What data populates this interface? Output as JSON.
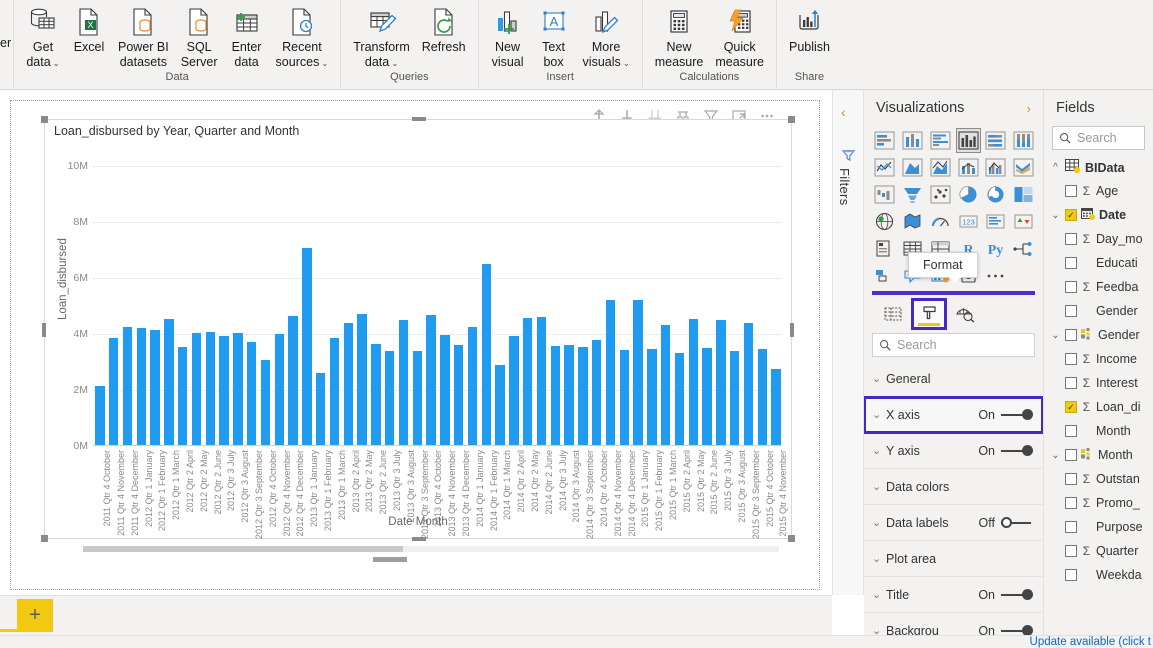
{
  "ribbon": {
    "cut_label": "er",
    "groups": [
      {
        "label": "Data",
        "buttons": [
          {
            "name": "get-data",
            "icon": "database-icon",
            "line1": "Get",
            "line2": "data",
            "caret": true
          },
          {
            "name": "excel",
            "icon": "excel-icon",
            "line1": "Excel",
            "line2": "",
            "caret": false
          },
          {
            "name": "power-bi-datasets",
            "icon": "powerbi-dataset-icon",
            "line1": "Power BI",
            "line2": "datasets",
            "caret": false
          },
          {
            "name": "sql-server",
            "icon": "sql-server-icon",
            "line1": "SQL",
            "line2": "Server",
            "caret": false
          },
          {
            "name": "enter-data",
            "icon": "grid-plus-icon",
            "line1": "Enter",
            "line2": "data",
            "caret": false
          },
          {
            "name": "recent-sources",
            "icon": "clock-page-icon",
            "line1": "Recent",
            "line2": "sources",
            "caret": true
          }
        ]
      },
      {
        "label": "Queries",
        "buttons": [
          {
            "name": "transform-data",
            "icon": "transform-pencil-icon",
            "line1": "Transform",
            "line2": "data",
            "caret": true
          },
          {
            "name": "refresh",
            "icon": "refresh-icon",
            "line1": "Refresh",
            "line2": "",
            "caret": false
          }
        ]
      },
      {
        "label": "Insert",
        "buttons": [
          {
            "name": "new-visual",
            "icon": "new-visual-icon",
            "line1": "New",
            "line2": "visual",
            "caret": false
          },
          {
            "name": "text-box",
            "icon": "text-box-icon",
            "line1": "Text",
            "line2": "box",
            "caret": false
          },
          {
            "name": "more-visuals",
            "icon": "more-visuals-icon",
            "line1": "More",
            "line2": "visuals",
            "caret": true
          }
        ]
      },
      {
        "label": "Calculations",
        "buttons": [
          {
            "name": "new-measure",
            "icon": "calculator-icon",
            "line1": "New",
            "line2": "measure",
            "caret": false
          },
          {
            "name": "quick-measure",
            "icon": "quick-measure-icon",
            "line1": "Quick",
            "line2": "measure",
            "caret": false
          }
        ]
      },
      {
        "label": "Share",
        "buttons": [
          {
            "name": "publish",
            "icon": "publish-icon",
            "line1": "Publish",
            "line2": "",
            "caret": false
          }
        ]
      }
    ]
  },
  "visual_header": {
    "icons": [
      {
        "name": "drill-up-icon",
        "title": "Drill up"
      },
      {
        "name": "drill-down-icon",
        "title": "Drill down"
      },
      {
        "name": "expand-all-icon",
        "title": "Expand all down one level"
      },
      {
        "name": "drill-mode-icon",
        "title": "Go to the next level"
      },
      {
        "name": "filter-icon",
        "title": "Filters"
      },
      {
        "name": "focus-mode-icon",
        "title": "Focus mode"
      },
      {
        "name": "more-options-icon",
        "title": "More options"
      }
    ]
  },
  "chart_data": {
    "type": "bar",
    "title": "Loan_disbursed by Year, Quarter and Month",
    "xlabel": "Date Month",
    "ylabel": "Loan_disbursed",
    "ylim": [
      0,
      10000000
    ],
    "ytick_labels": [
      "0M",
      "2M",
      "4M",
      "6M",
      "8M",
      "10M"
    ],
    "ytick_values": [
      0,
      2000000,
      4000000,
      6000000,
      8000000,
      10000000
    ],
    "grid": true,
    "legend": "none",
    "bar_color": "#1f9cf0",
    "categories": [
      "2011 Qtr 4 October",
      "2011 Qtr 4 November",
      "2011 Qtr 4 December",
      "2012 Qtr 1 January",
      "2012 Qtr 1 February",
      "2012 Qtr 1 March",
      "2012 Qtr 2 April",
      "2012 Qtr 2 May",
      "2012 Qtr 2 June",
      "2012 Qtr 3 July",
      "2012 Qtr 3 August",
      "2012 Qtr 3 September",
      "2012 Qtr 4 October",
      "2012 Qtr 4 November",
      "2012 Qtr 4 December",
      "2013 Qtr 1 January",
      "2013 Qtr 1 February",
      "2013 Qtr 1 March",
      "2013 Qtr 2 April",
      "2013 Qtr 2 May",
      "2013 Qtr 2 June",
      "2013 Qtr 3 July",
      "2013 Qtr 3 August",
      "2013 Qtr 3 September",
      "2013 Qtr 4 October",
      "2013 Qtr 4 November",
      "2013 Qtr 4 December",
      "2014 Qtr 1 January",
      "2014 Qtr 1 February",
      "2014 Qtr 1 March",
      "2014 Qtr 2 April",
      "2014 Qtr 2 May",
      "2014 Qtr 2 June",
      "2014 Qtr 3 July",
      "2014 Qtr 3 August",
      "2014 Qtr 3 September",
      "2014 Qtr 4 October",
      "2014 Qtr 4 November",
      "2014 Qtr 4 December",
      "2015 Qtr 1 January",
      "2015 Qtr 1 February",
      "2015 Qtr 1 March",
      "2015 Qtr 2 April",
      "2015 Qtr 2 May",
      "2015 Qtr 2 June",
      "2015 Qtr 3 July",
      "2015 Qtr 3 August",
      "2015 Qtr 3 September",
      "2015 Qtr 4 October",
      "2015 Qtr 4 November"
    ],
    "values": [
      2150000,
      3840000,
      4240000,
      4230000,
      4150000,
      4520000,
      3540000,
      4050000,
      4060000,
      3930000,
      4020000,
      3720000,
      3060000,
      4000000,
      4630000,
      7060000,
      2620000,
      3840000,
      4380000,
      4730000,
      3660000,
      3380000,
      4490000,
      3400000,
      4690000,
      3980000,
      3600000,
      4240000,
      6490000,
      2880000,
      3930000,
      4570000,
      4590000,
      3580000,
      3620000,
      3520000,
      3780000,
      5230000,
      3440000,
      5200000,
      3460000,
      4320000,
      3310000,
      4520000,
      3500000,
      4490000,
      3400000,
      4380000,
      3480000,
      2760000
    ]
  },
  "visual_scrollbar": {
    "name": "visual-horizontal-scrollbar"
  },
  "filters_pane": {
    "label": "Filters",
    "collapse_icon": "chevron-left-icon",
    "filter_icon": "filter-icon"
  },
  "visualizations": {
    "title": "Visualizations",
    "expand_icon": "chevron-right-icon",
    "tooltip": "Format",
    "icons": [
      "stacked-bar-chart-icon",
      "stacked-column-chart-icon",
      "clustered-bar-chart-icon",
      "clustered-column-chart-icon",
      "100-stacked-bar-chart-icon",
      "100-stacked-column-chart-icon",
      "line-chart-icon",
      "area-chart-icon",
      "stacked-area-chart-icon",
      "line-stacked-column-chart-icon",
      "line-clustered-column-chart-icon",
      "ribbon-chart-icon",
      "waterfall-chart-icon",
      "funnel-chart-icon",
      "scatter-chart-icon",
      "pie-chart-icon",
      "donut-chart-icon",
      "treemap-icon",
      "map-icon",
      "filled-map-icon",
      "gauge-icon",
      "card-icon",
      "multi-row-card-icon",
      "kpi-icon",
      "slicer-icon",
      "table-icon",
      "matrix-icon",
      "r-script-visual-icon",
      "python-visual-icon",
      "key-influencers-icon",
      "decomposition-tree-icon",
      "q-and-a-icon",
      "smart-narrative-icon",
      "paginated-report-icon",
      "get-more-visuals-icon"
    ],
    "selected_icon_index": 3,
    "tabs": [
      {
        "name": "fields-tab",
        "icon": "fields-table-icon",
        "active": false
      },
      {
        "name": "format-tab",
        "icon": "paint-roller-icon",
        "active": true
      },
      {
        "name": "analytics-tab",
        "icon": "magnifier-chart-icon",
        "active": false
      }
    ],
    "search_placeholder": "Search",
    "format_rows": [
      {
        "name": "general",
        "label": "General",
        "state": "",
        "toggle": "none",
        "highlight": false
      },
      {
        "name": "x-axis",
        "label": "X axis",
        "state": "On",
        "toggle": "on",
        "highlight": true
      },
      {
        "name": "y-axis",
        "label": "Y axis",
        "state": "On",
        "toggle": "on",
        "highlight": false
      },
      {
        "name": "data-colors",
        "label": "Data colors",
        "state": "",
        "toggle": "none",
        "highlight": false
      },
      {
        "name": "data-labels",
        "label": "Data labels",
        "state": "Off",
        "toggle": "off",
        "highlight": false
      },
      {
        "name": "plot-area",
        "label": "Plot area",
        "state": "",
        "toggle": "none",
        "highlight": false
      },
      {
        "name": "title",
        "label": "Title",
        "state": "On",
        "toggle": "on",
        "highlight": false
      },
      {
        "name": "background",
        "label": "Backgrou",
        "state": "On",
        "toggle": "on",
        "highlight": false
      }
    ]
  },
  "fields": {
    "title": "Fields",
    "search_placeholder": "Search",
    "table": {
      "name": "BIData",
      "expanded": true,
      "checked": true
    },
    "items": [
      {
        "label": "Age",
        "checked": false,
        "sigma": true,
        "chev": false,
        "hierarchy": false
      },
      {
        "label": "Date",
        "checked": true,
        "sigma": false,
        "chev": true,
        "hierarchy": false,
        "calendar": true,
        "bold": true
      },
      {
        "label": "Day_mo",
        "checked": false,
        "sigma": true,
        "chev": false,
        "hierarchy": false
      },
      {
        "label": "Educati",
        "checked": false,
        "sigma": false,
        "chev": false,
        "hierarchy": false
      },
      {
        "label": "Feedba",
        "checked": false,
        "sigma": true,
        "chev": false,
        "hierarchy": false
      },
      {
        "label": "Gender",
        "checked": false,
        "sigma": false,
        "chev": false,
        "hierarchy": false
      },
      {
        "label": "Gender",
        "checked": false,
        "sigma": false,
        "chev": true,
        "hierarchy": true
      },
      {
        "label": "Income",
        "checked": false,
        "sigma": true,
        "chev": false,
        "hierarchy": false
      },
      {
        "label": "Interest",
        "checked": false,
        "sigma": true,
        "chev": false,
        "hierarchy": false
      },
      {
        "label": "Loan_di",
        "checked": true,
        "sigma": true,
        "chev": false,
        "hierarchy": false
      },
      {
        "label": "Month",
        "checked": false,
        "sigma": false,
        "chev": false,
        "hierarchy": false
      },
      {
        "label": "Month",
        "checked": false,
        "sigma": false,
        "chev": true,
        "hierarchy": true
      },
      {
        "label": "Outstan",
        "checked": false,
        "sigma": true,
        "chev": false,
        "hierarchy": false
      },
      {
        "label": "Promo_",
        "checked": false,
        "sigma": true,
        "chev": false,
        "hierarchy": false
      },
      {
        "label": "Purpose",
        "checked": false,
        "sigma": false,
        "chev": false,
        "hierarchy": false
      },
      {
        "label": "Quarter",
        "checked": false,
        "sigma": true,
        "chev": false,
        "hierarchy": false
      },
      {
        "label": "Weekda",
        "checked": false,
        "sigma": false,
        "chev": false,
        "hierarchy": false
      }
    ]
  },
  "bottom": {
    "add_page_label": "+",
    "update_message": "Update available (click t"
  }
}
